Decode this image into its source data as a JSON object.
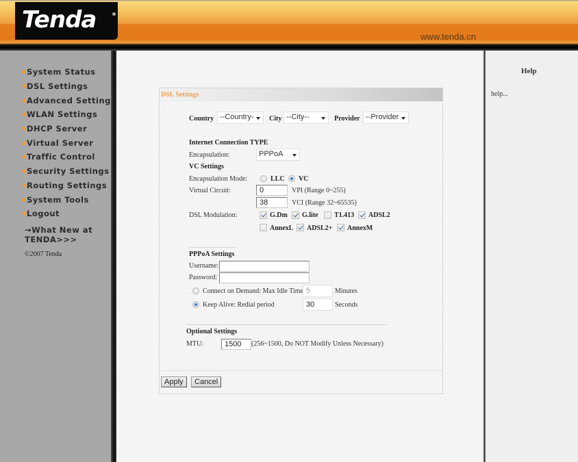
{
  "header": {
    "logo_text": "Tenda",
    "site_url": "www.tenda.cn"
  },
  "sidebar": {
    "items": [
      {
        "label": "System Status"
      },
      {
        "label": "DSL Settings"
      },
      {
        "label": "Advanced Settings"
      },
      {
        "label": "WLAN Settings"
      },
      {
        "label": "DHCP Server"
      },
      {
        "label": "Virtual Server"
      },
      {
        "label": "Traffic Control"
      },
      {
        "label": "Security Settings"
      },
      {
        "label": "Routing Settings"
      },
      {
        "label": "System Tools"
      },
      {
        "label": "Logout"
      }
    ],
    "whats_new": "→What New at TENDA>>>",
    "copyright": "©2007 Tenda"
  },
  "help": {
    "title": "Help",
    "text": "help..."
  },
  "panel": {
    "title": "DSL Settings",
    "location": {
      "country_label": "Country",
      "country_value": "--Country-",
      "city_label": "City",
      "city_value": "--City--",
      "provider_label": "Provider",
      "provider_value": "--Provider"
    },
    "connection": {
      "section_title": "Internet Connection TYPE",
      "encapsulation_label": "Encapsulation:",
      "encapsulation_value": "PPPoA"
    },
    "vc": {
      "section_title": "VC Settings",
      "mode_label": "Encapsulation Mode:",
      "mode_options": [
        {
          "label": "LLC",
          "selected": false
        },
        {
          "label": "VC",
          "selected": true
        }
      ],
      "circuit_label": "Virtual Circuit:",
      "vpi_value": "0",
      "vpi_hint": "VPI (Range 0~255)",
      "vci_value": "38",
      "vci_hint": "VCI (Range 32~65535)",
      "modulation_label": "DSL Modulation:",
      "modulations": [
        {
          "label": "G.Dm",
          "checked": true
        },
        {
          "label": "G.lite",
          "checked": true
        },
        {
          "label": "T1.413",
          "checked": false
        },
        {
          "label": "ADSL2",
          "checked": true
        },
        {
          "label": "AnnexL",
          "checked": false
        },
        {
          "label": "ADSL2+",
          "checked": true
        },
        {
          "label": "AnnexM",
          "checked": true
        }
      ]
    },
    "pppoa": {
      "section_title": "PPPoA Settings",
      "username_label": "Username:",
      "username_value": "",
      "password_label": "Password:",
      "password_value": "",
      "on_demand_label": "Connect on Demand: Max Idle Time",
      "on_demand_selected": false,
      "idle_value": "5",
      "idle_unit": "Minutes",
      "keep_alive_label": "Keep Alive: Redial period",
      "keep_alive_selected": true,
      "redial_value": "30",
      "redial_unit": "Seconds"
    },
    "optional": {
      "section_title": "Optional Settings",
      "mtu_label": "MTU:",
      "mtu_value": "1500",
      "mtu_hint": "(256~1500, Do NOT Modify Unless Necessary)"
    },
    "buttons": {
      "apply": "Apply",
      "cancel": "Cancel"
    }
  },
  "colors": {
    "header_orange": "#e37a1a",
    "bullet_orange": "#f39a33",
    "panel_title": "#f0a050",
    "sidebar_bg": "#a8a8a8"
  }
}
